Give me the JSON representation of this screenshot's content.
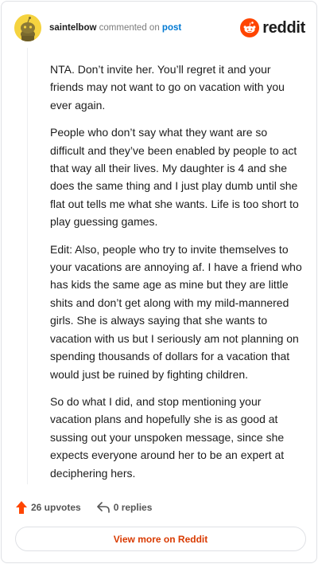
{
  "header": {
    "username": "saintelbow",
    "action_text": "commented on",
    "post_link": "post",
    "brand": "reddit"
  },
  "comment": {
    "paragraphs": [
      "NTA. Don’t invite her. You’ll regret it and your friends may not want to go on vacation with you ever again.",
      "People who don’t say what they want are so difficult and they’ve been enabled by people to act that way all their lives. My daughter is 4 and she does the same thing and I just play dumb until she flat out tells me what she wants. Life is too short to play guessing games.",
      "Edit: Also, people who try to invite themselves to your vacations are annoying af. I have a friend who has kids the same age as mine but they are little shits and don’t get along with my mild-mannered girls. She is always saying that she wants to vacation with us but I seriously am not planning on spending thousands of dollars for a vacation that would just be ruined by fighting children.",
      "So do what I did, and stop mentioning your vacation plans and hopefully she is as good at sussing out your unspoken message, since she expects everyone around her to be an expert at deciphering hers."
    ]
  },
  "actions": {
    "upvotes": "26 upvotes",
    "replies": "0 replies"
  },
  "footer": {
    "view_more": "View more on Reddit"
  },
  "colors": {
    "brand_orange": "#ff4500",
    "link_blue": "#0079d3",
    "button_text": "#d93a00",
    "avatar_yellow": "#f5d33f"
  },
  "icons": [
    "snoo-avatar-icon",
    "reddit-logo-icon",
    "upvote-arrow-icon",
    "reply-arrow-icon"
  ]
}
